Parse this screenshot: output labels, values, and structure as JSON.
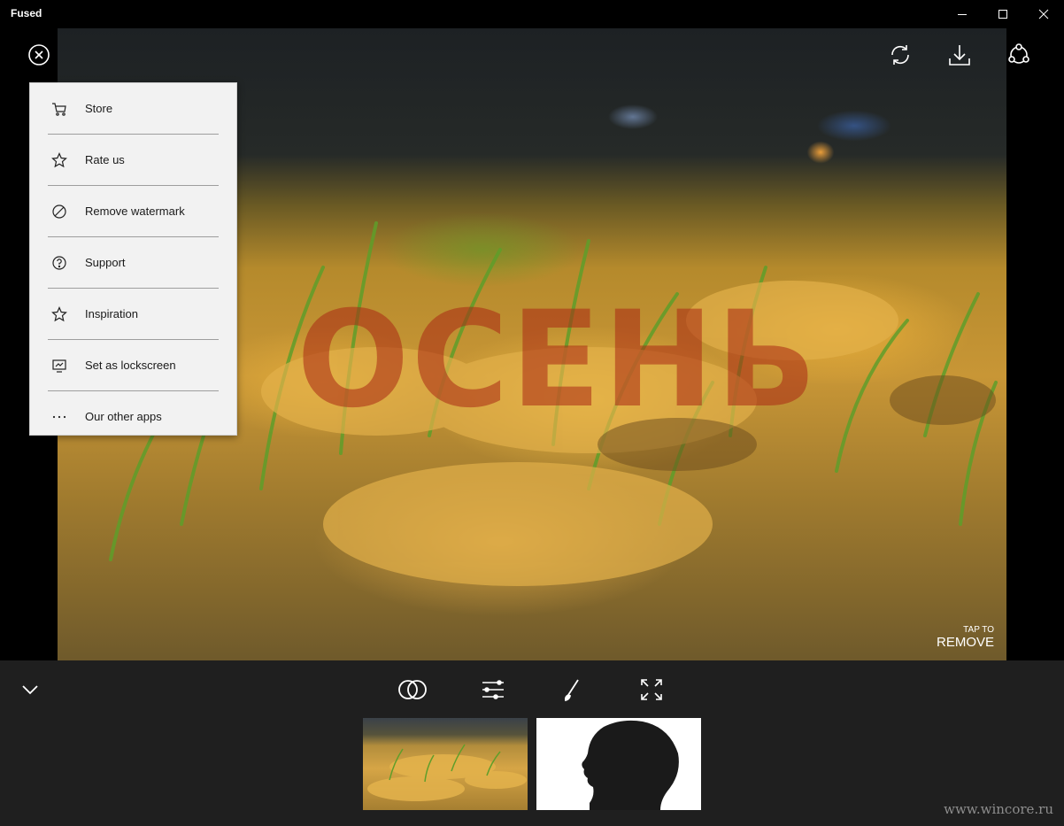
{
  "window": {
    "title": "Fused"
  },
  "photo": {
    "watermark_text": "ОСЕНЬ",
    "tap_small": "TAP TO",
    "tap_big": "REMOVE"
  },
  "menu": {
    "items": [
      {
        "label": "Store",
        "icon": "cart-icon"
      },
      {
        "label": "Rate us",
        "icon": "star-icon"
      },
      {
        "label": "Remove watermark",
        "icon": "prohibit-icon"
      },
      {
        "label": "Support",
        "icon": "help-icon"
      },
      {
        "label": "Inspiration",
        "icon": "star-icon"
      },
      {
        "label": "Set as lockscreen",
        "icon": "lockscreen-icon"
      },
      {
        "label": "Our other apps",
        "icon": "more-icon"
      }
    ]
  },
  "toolbar_icons": [
    "close-circle-icon",
    "refresh-icon",
    "download-icon",
    "share-icon"
  ],
  "bottom_icons": [
    "chevron-down-icon",
    "blend-icon",
    "adjust-icon",
    "brush-icon",
    "fullscreen-icon"
  ],
  "site_watermark": "www.wincore.ru"
}
